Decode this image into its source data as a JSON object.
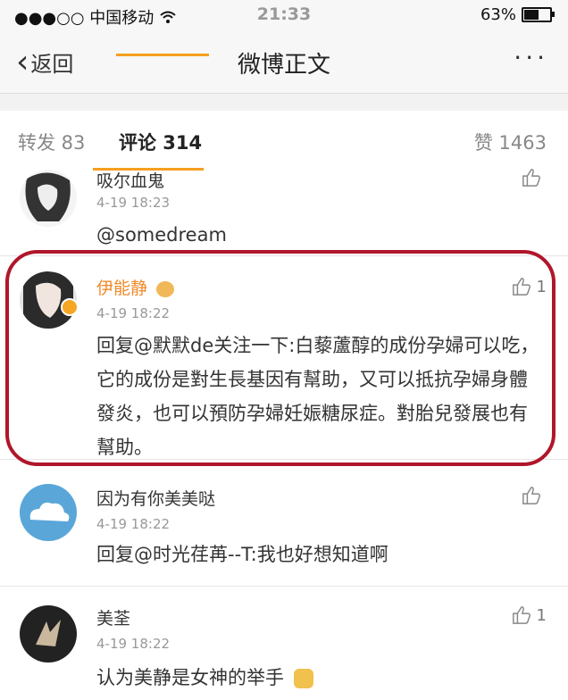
{
  "status_bar": {
    "carrier": "●●●○○ 中国移动",
    "time": "21:33",
    "battery_text": "63%",
    "battery_level": 0.63
  },
  "nav": {
    "back_label": "返回",
    "title": "微博正文",
    "more_label": "···"
  },
  "tabs": {
    "repost": "转发 83",
    "comment": "评论 314",
    "like": "赞 1463"
  },
  "comments": [
    {
      "name": "吸尔血鬼",
      "time": "4-19 18:23",
      "text": "@somedream",
      "like": ""
    },
    {
      "name": "伊能静",
      "time": "4-19 18:22",
      "text": "回复@默默de关注一下:白藜蘆醇的成份孕婦可以吃，它的成份是對生長基因有幫助，又可以抵抗孕婦身體發炎，也可以預防孕婦妊娠糖尿症。對胎兒發展也有幫助。",
      "like": "1"
    },
    {
      "name": "因为有你美美哒",
      "time": "4-19 18:22",
      "text": "回复@时光荏苒--T:我也好想知道啊",
      "like": ""
    },
    {
      "name": "美荃",
      "time": "4-19 18:22",
      "text": "认为美静是女神的举手",
      "like": "1"
    }
  ],
  "colors": {
    "accent": "#f59f1f",
    "highlight": "#b0162b",
    "vip_name": "#f08a2a"
  }
}
